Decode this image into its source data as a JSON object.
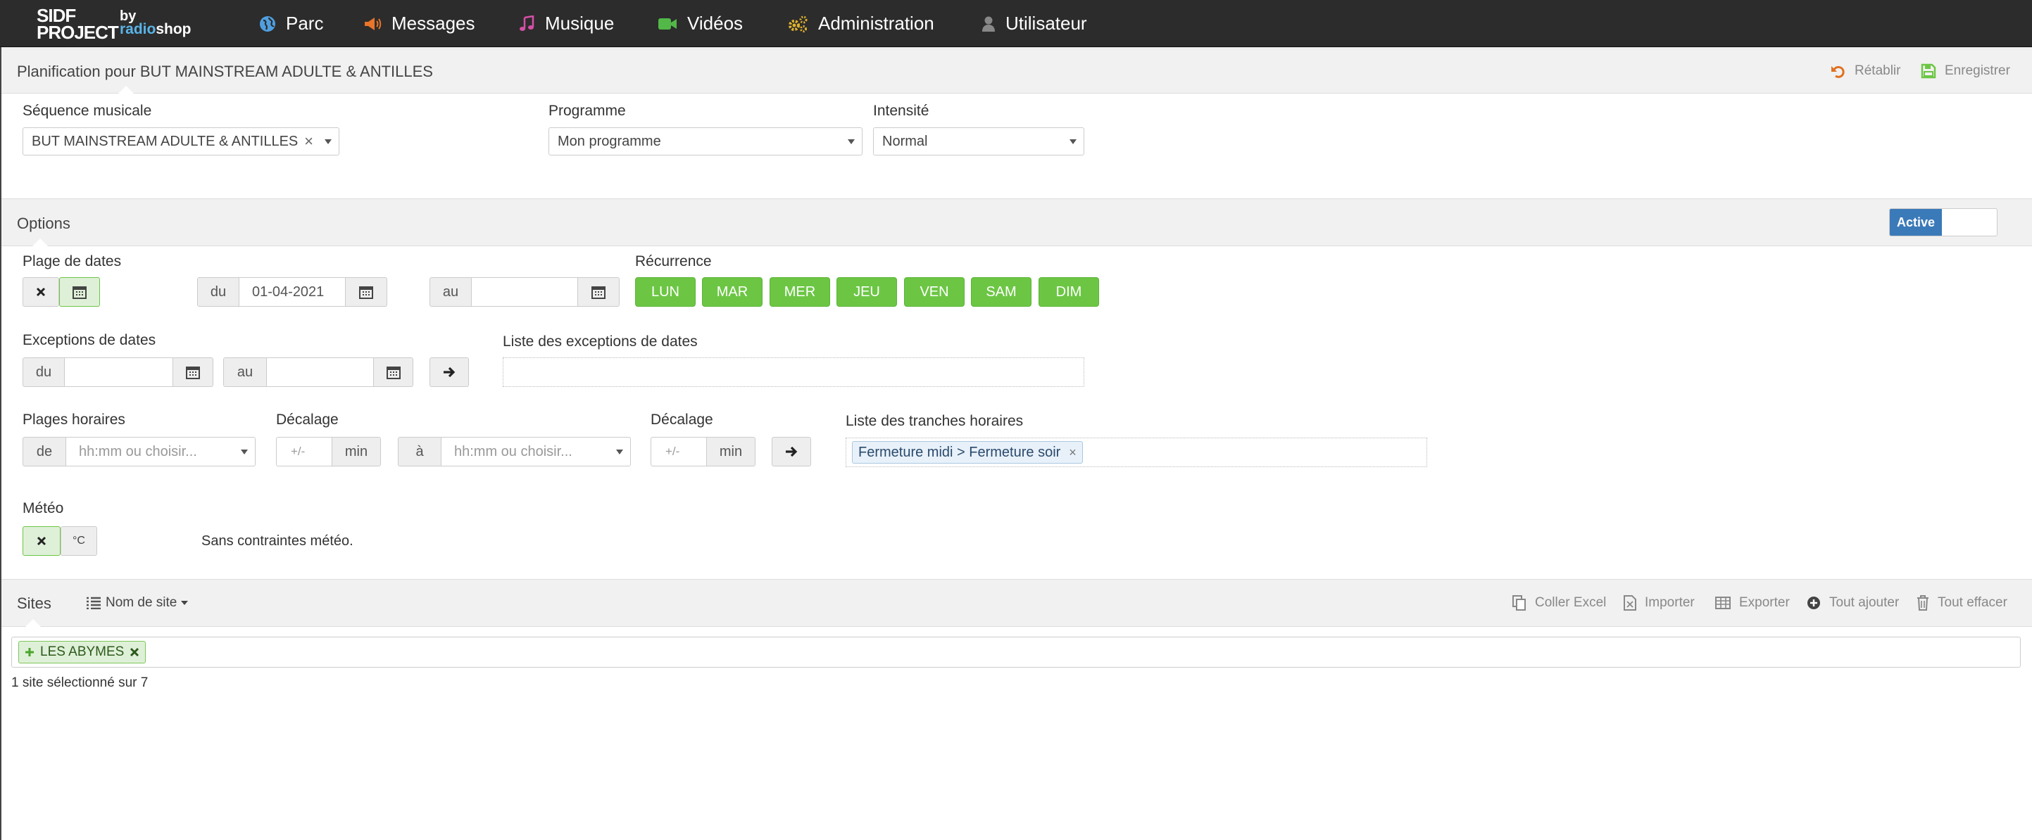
{
  "brand": {
    "line1": "SIDF",
    "line2": "PROJECT",
    "by": "by",
    "radio": "radio",
    "shop": "shop"
  },
  "nav": [
    {
      "label": "Parc",
      "icon": "globe-icon"
    },
    {
      "label": "Messages",
      "icon": "megaphone-icon"
    },
    {
      "label": "Musique",
      "icon": "music-icon"
    },
    {
      "label": "Vidéos",
      "icon": "video-camera-icon"
    },
    {
      "label": "Administration",
      "icon": "cogs-icon"
    },
    {
      "label": "Utilisateur",
      "icon": "user-icon"
    }
  ],
  "planning": {
    "title": "Planification pour BUT MAINSTREAM ADULTE & ANTILLES",
    "reset_label": "Rétablir",
    "save_label": "Enregistrer",
    "sequence_label": "Séquence musicale",
    "sequence_value": "BUT MAINSTREAM ADULTE & ANTILLES",
    "program_label": "Programme",
    "program_value": "Mon programme",
    "intensity_label": "Intensité",
    "intensity_value": "Normal"
  },
  "options": {
    "title": "Options",
    "toggle_label": "Active",
    "date_range_label": "Plage de dates",
    "from_addon": "du",
    "to_addon": "au",
    "date_from_value": "01-04-2021",
    "date_to_value": "",
    "recurrence_label": "Récurrence",
    "days": [
      "LUN",
      "MAR",
      "MER",
      "JEU",
      "VEN",
      "SAM",
      "DIM"
    ],
    "exceptions_label": "Exceptions de dates",
    "exceptions_from_value": "",
    "exceptions_to_value": "",
    "exceptions_list_label": "Liste des exceptions de dates",
    "time_ranges_label": "Plages horaires",
    "de_addon": "de",
    "a_addon": "à",
    "time_placeholder": "hh:mm ou choisir...",
    "offset_label": "Décalage",
    "offset_placeholder": "+/-",
    "min_addon": "min",
    "time_slots_list_label": "Liste des tranches horaires",
    "time_slot_tag": "Fermeture midi > Fermeture soir",
    "weather_label": "Météo",
    "weather_unit": "°C",
    "weather_text": "Sans contraintes météo."
  },
  "sites": {
    "title": "Sites",
    "sort_label": "Nom de site",
    "actions": [
      "Coller Excel",
      "Importer",
      "Exporter",
      "Tout ajouter",
      "Tout effacer"
    ],
    "selected_tag": "LES ABYMES",
    "count_text": "1 site sélectionné sur 7"
  },
  "colors": {
    "navbar": "#2c2c2c",
    "day_green": "#6cc644",
    "active_blue": "#3b7ab8",
    "reset_orange": "#e07020",
    "save_green": "#6cc644"
  }
}
